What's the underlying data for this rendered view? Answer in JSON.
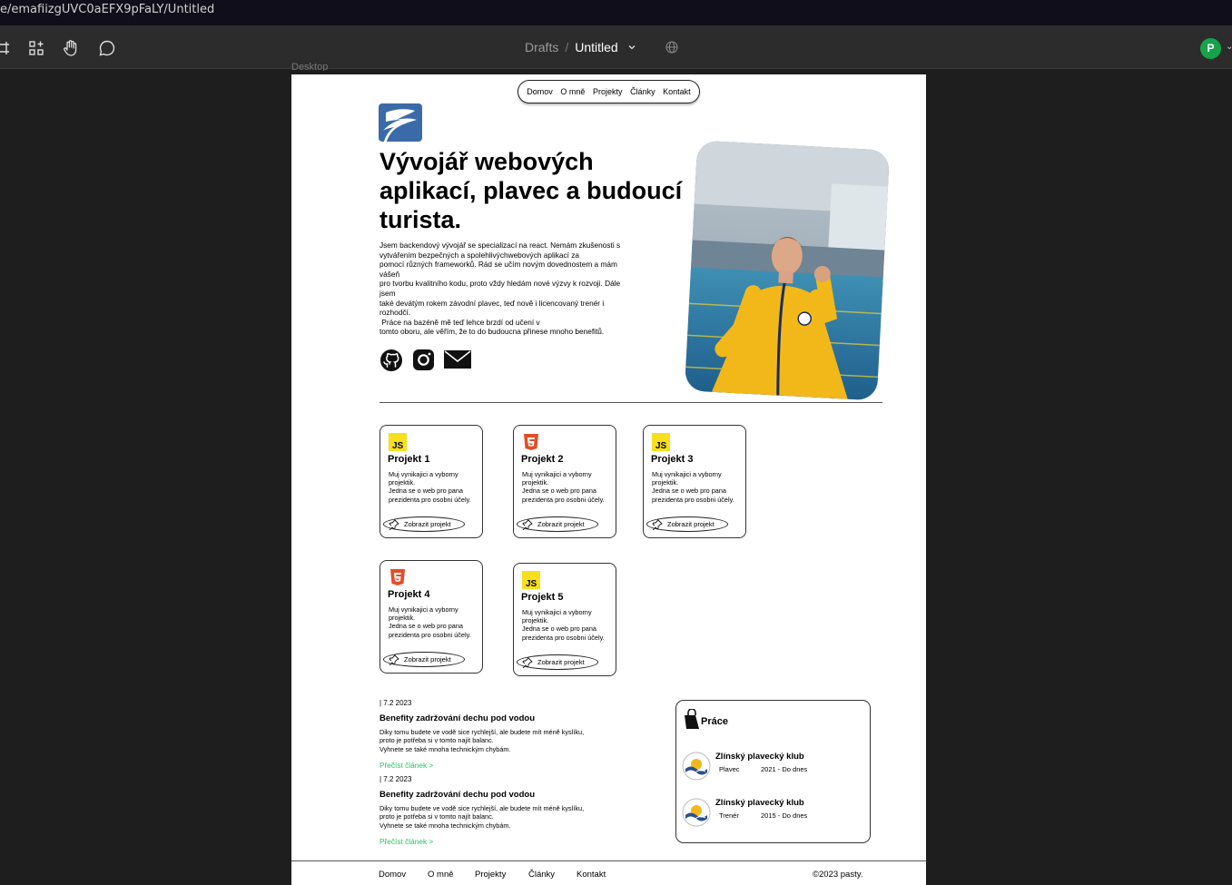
{
  "browser": {
    "url": "e/emafiizgUVC0aEFX9pFaLY/Untitled"
  },
  "toolbar": {
    "tools": [
      "frame-icon",
      "components-icon",
      "hand-icon",
      "comment-icon"
    ],
    "breadcrumb_parent": "Drafts",
    "breadcrumb_separator": "/",
    "file_name": "Untitled",
    "avatar_initial": "P",
    "avatar_color": "#16a34a"
  },
  "canvas": {
    "frame_label": "Desktop"
  },
  "site": {
    "nav": [
      "Domov",
      "O mně",
      "Projekty",
      "Články",
      "Kontakt"
    ],
    "hero": {
      "heading": "Vývojář webových aplikací, plavec a budoucí turista.",
      "intro_lines": [
        "Jsem backendový vývojář se specializací na react. Nemám zkušenosti s",
        "vytvářením bezpečných a spolehlivýchwebových aplikací za",
        "pomocí různých frameworků. Rád se učím novým dovednostem a mám vášeň",
        "pro tvorbu kvalitního kodu, proto vždy hledám nové výzvy k rozvoji. Dále jsem",
        "také devátým rokem závodní plavec, teď nově i licencovaný trenér i rozhodčí.",
        " Práce na bazéně mě teď lehce brzdí od učení v",
        "tomto oboru, ale věřím, že to do budoucna přinese mnoho benefitů."
      ],
      "social": [
        "github-icon",
        "instagram-icon",
        "mail-icon"
      ]
    },
    "projects": [
      {
        "title": "Projekt 1",
        "tech": "JS",
        "desc_lines": [
          "Muj vynikajici a vyborny projektik.",
          "Jedna se o web pro pana prezidenta pro osobni účely."
        ],
        "button": "Zobrazit projekt"
      },
      {
        "title": "Projekt 2",
        "tech": "HTML5",
        "desc_lines": [
          "Muj vynikajici a vyborny projektik.",
          "Jedna se o web pro pana prezidenta pro osobni účely."
        ],
        "button": "Zobrazit projekt"
      },
      {
        "title": "Projekt 3",
        "tech": "JS",
        "desc_lines": [
          "Muj vynikajici a vyborny projektik.",
          "Jedna se o web pro pana prezidenta pro osobni účely."
        ],
        "button": "Zobrazit projekt"
      },
      {
        "title": "Projekt 4",
        "tech": "HTML5",
        "desc_lines": [
          "Muj vynikajici a vyborny projektik.",
          "Jedna se o web pro pana prezidenta pro osobni účely."
        ],
        "button": "Zobrazit projekt"
      },
      {
        "title": "Projekt 5",
        "tech": "JS",
        "desc_lines": [
          "Muj vynikajici a vyborny projektik.",
          "Jedna se o web pro pana prezidenta pro osobni účely."
        ],
        "button": "Zobrazit projekt"
      }
    ],
    "articles": [
      {
        "date": "| 7.2 2023",
        "title": "Benefity zadržování dechu pod vodou",
        "body_lines": [
          "Diky tomu budete ve vodě sice rychlejší, ale budete mít méně kyslíku,",
          "proto je potřeba si v tomto najít balanc.",
          "Vyhnete se také mnoha technickým chybám."
        ],
        "link": "Přečíst článek >"
      },
      {
        "date": "| 7.2 2023",
        "title": "Benefity zadržování dechu pod vodou",
        "body_lines": [
          "Diky tomu budete ve vodě sice rychlejší, ale budete mít méně kyslíku,",
          "proto je potřeba si v tomto najít balanc.",
          "Vyhnete se také mnoha technickým chybám."
        ],
        "link": "Přečíst článek >"
      }
    ],
    "work": {
      "title": "Práce",
      "items": [
        {
          "name": "Zlínský plavecký klub",
          "role": "Plavec",
          "years": "2021 - Do dnes"
        },
        {
          "name": "Zlínský plavecký klub",
          "role": "Trenér",
          "years": "2015 - Do dnes"
        }
      ]
    },
    "footer": {
      "links": [
        "Domov",
        "O mně",
        "Projekty",
        "Články",
        "Kontakt"
      ],
      "copyright": "©2023 pasty."
    },
    "colors": {
      "accent_green": "#22c55e",
      "logo_blue": "#3b6aa8",
      "js_yellow": "#f7df1e",
      "html_orange": "#e44d26"
    }
  }
}
